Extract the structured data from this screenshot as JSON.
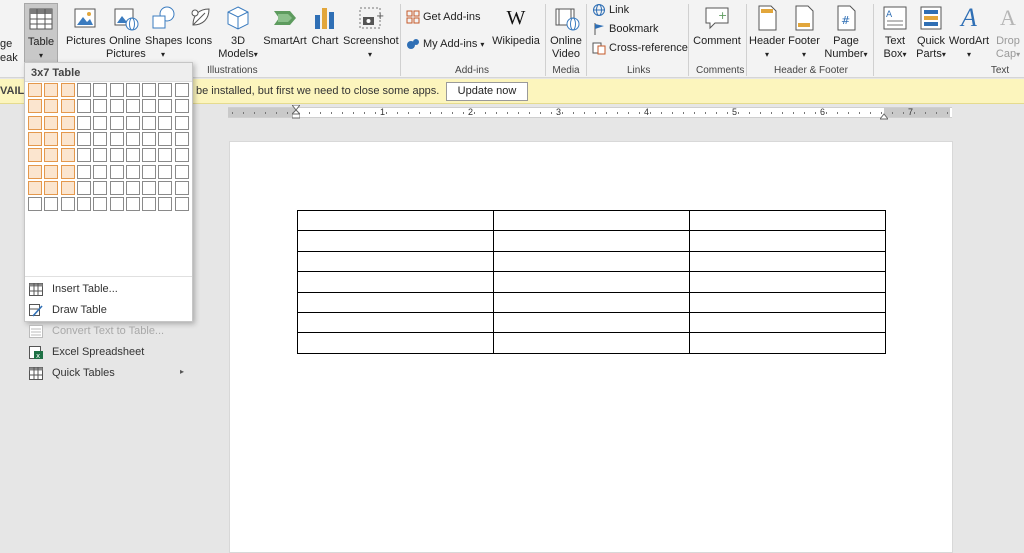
{
  "ribbon": {
    "left_partial_1": "ge",
    "left_partial_2": "eak",
    "table_label": "Table",
    "table_arrow": "▾",
    "pictures_label": "Pictures",
    "online_pictures_label_1": "Online",
    "online_pictures_label_2": "Pictures",
    "shapes_label": "Shapes",
    "icons_label": "Icons",
    "models_label_1": "3D",
    "models_label_2": "Models",
    "smartart_label": "SmartArt",
    "chart_label": "Chart",
    "screenshot_label": "Screenshot",
    "get_addins_label": "Get Add-ins",
    "my_addins_label": "My Add-ins",
    "wikipedia_label": "Wikipedia",
    "online_video_label_1": "Online",
    "online_video_label_2": "Video",
    "link_label": "Link",
    "bookmark_label": "Bookmark",
    "crossref_label": "Cross-reference",
    "comment_label": "Comment",
    "header_label": "Header",
    "footer_label": "Footer",
    "page_number_label_1": "Page",
    "page_number_label_2": "Number",
    "textbox_label_1": "Text",
    "textbox_label_2": "Box",
    "quickparts_label_1": "Quick",
    "quickparts_label_2": "Parts",
    "wordart_label": "WordArt",
    "dropcap_label_1": "Drop",
    "dropcap_label_2": "Cap",
    "groups": {
      "illustrations": "Illustrations",
      "addins": "Add-ins",
      "media": "Media",
      "links": "Links",
      "comments": "Comments",
      "header_footer": "Header & Footer",
      "text": "Text"
    }
  },
  "notification": {
    "left_text": "VAILA",
    "message": "be installed, but first we need to close some apps.",
    "update_button": "Update now"
  },
  "ruler": {
    "numbers": [
      "1",
      "2",
      "3",
      "4",
      "5",
      "6",
      "7"
    ]
  },
  "table_menu": {
    "title": "3x7 Table",
    "grid_cols": 10,
    "grid_rows": 8,
    "selected_cols": 3,
    "selected_rows": 7,
    "items": [
      {
        "label": "Insert Table...",
        "icon": "insert-table-icon",
        "disabled": false,
        "submenu": false
      },
      {
        "label": "Draw Table",
        "icon": "draw-table-icon",
        "disabled": false,
        "submenu": false
      },
      {
        "label": "Convert Text to Table...",
        "icon": "convert-text-icon",
        "disabled": true,
        "submenu": false
      },
      {
        "label": "Excel Spreadsheet",
        "icon": "excel-icon",
        "disabled": false,
        "submenu": false
      },
      {
        "label": "Quick Tables",
        "icon": "quick-tables-icon",
        "disabled": false,
        "submenu": true
      }
    ],
    "submenu_arrow": "▸"
  },
  "document": {
    "table_cols": 3,
    "table_rows": 7
  },
  "colors": {
    "ribbon_bg": "#f3f3f3",
    "notify_bg": "#fcf5bd",
    "grid_selected": "#e4984c",
    "chart_blue": "#2f6fb5",
    "chart_gold": "#e2a63b"
  }
}
